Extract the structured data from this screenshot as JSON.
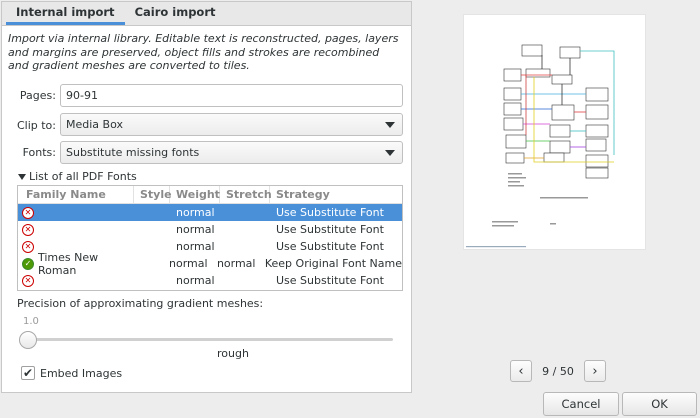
{
  "tabs": [
    {
      "label": "Internal import",
      "active": true
    },
    {
      "label": "Cairo import",
      "active": false
    }
  ],
  "description": "Import via internal library. Editable text is reconstructed, pages, layers and margins are preserved, object fills and strokes are recombined and gradient meshes are converted to tiles.",
  "form": {
    "pages_label": "Pages:",
    "pages_value": "90-91",
    "clip_label": "Clip to:",
    "clip_value": "Media Box",
    "fonts_label": "Fonts:",
    "fonts_value": "Substitute missing fonts"
  },
  "fonts_list": {
    "expander_label": "List of all PDF Fonts",
    "columns": [
      "Family Name",
      "Style",
      "Weight",
      "Stretch",
      "Strategy"
    ],
    "rows": [
      {
        "status": "substitute",
        "status_icon": "error-circle-icon",
        "family": "",
        "style": "",
        "weight": "normal",
        "stretch": "",
        "strategy": "Use Substitute Font",
        "selected": true
      },
      {
        "status": "substitute",
        "status_icon": "error-circle-icon",
        "family": "",
        "style": "",
        "weight": "normal",
        "stretch": "",
        "strategy": "Use Substitute Font",
        "selected": false
      },
      {
        "status": "substitute",
        "status_icon": "error-circle-icon",
        "family": "",
        "style": "",
        "weight": "normal",
        "stretch": "",
        "strategy": "Use Substitute Font",
        "selected": false
      },
      {
        "status": "keep",
        "status_icon": "checkmark-circle-icon",
        "family": "Times New Roman",
        "style": "",
        "weight": "normal",
        "stretch": "normal",
        "strategy": "Keep Original Font Name",
        "selected": false
      },
      {
        "status": "substitute",
        "status_icon": "error-circle-icon",
        "family": "",
        "style": "",
        "weight": "normal",
        "stretch": "",
        "strategy": "Use Substitute Font",
        "selected": false
      }
    ]
  },
  "precision": {
    "label": "Precision of approximating gradient meshes:",
    "value_display": "1.0",
    "value": 1.0,
    "mark_label": "rough"
  },
  "embed_images": {
    "label": "Embed Images",
    "checked": true
  },
  "pager": {
    "prev_icon": "chevron-left-icon",
    "next_icon": "chevron-right-icon",
    "text": "9 / 50",
    "current": 9,
    "total": 50
  },
  "buttons": {
    "cancel": "Cancel",
    "ok": "OK"
  },
  "colors": {
    "selection": "#4a90d9",
    "error": "#cc0000",
    "success": "#4e9a06"
  }
}
